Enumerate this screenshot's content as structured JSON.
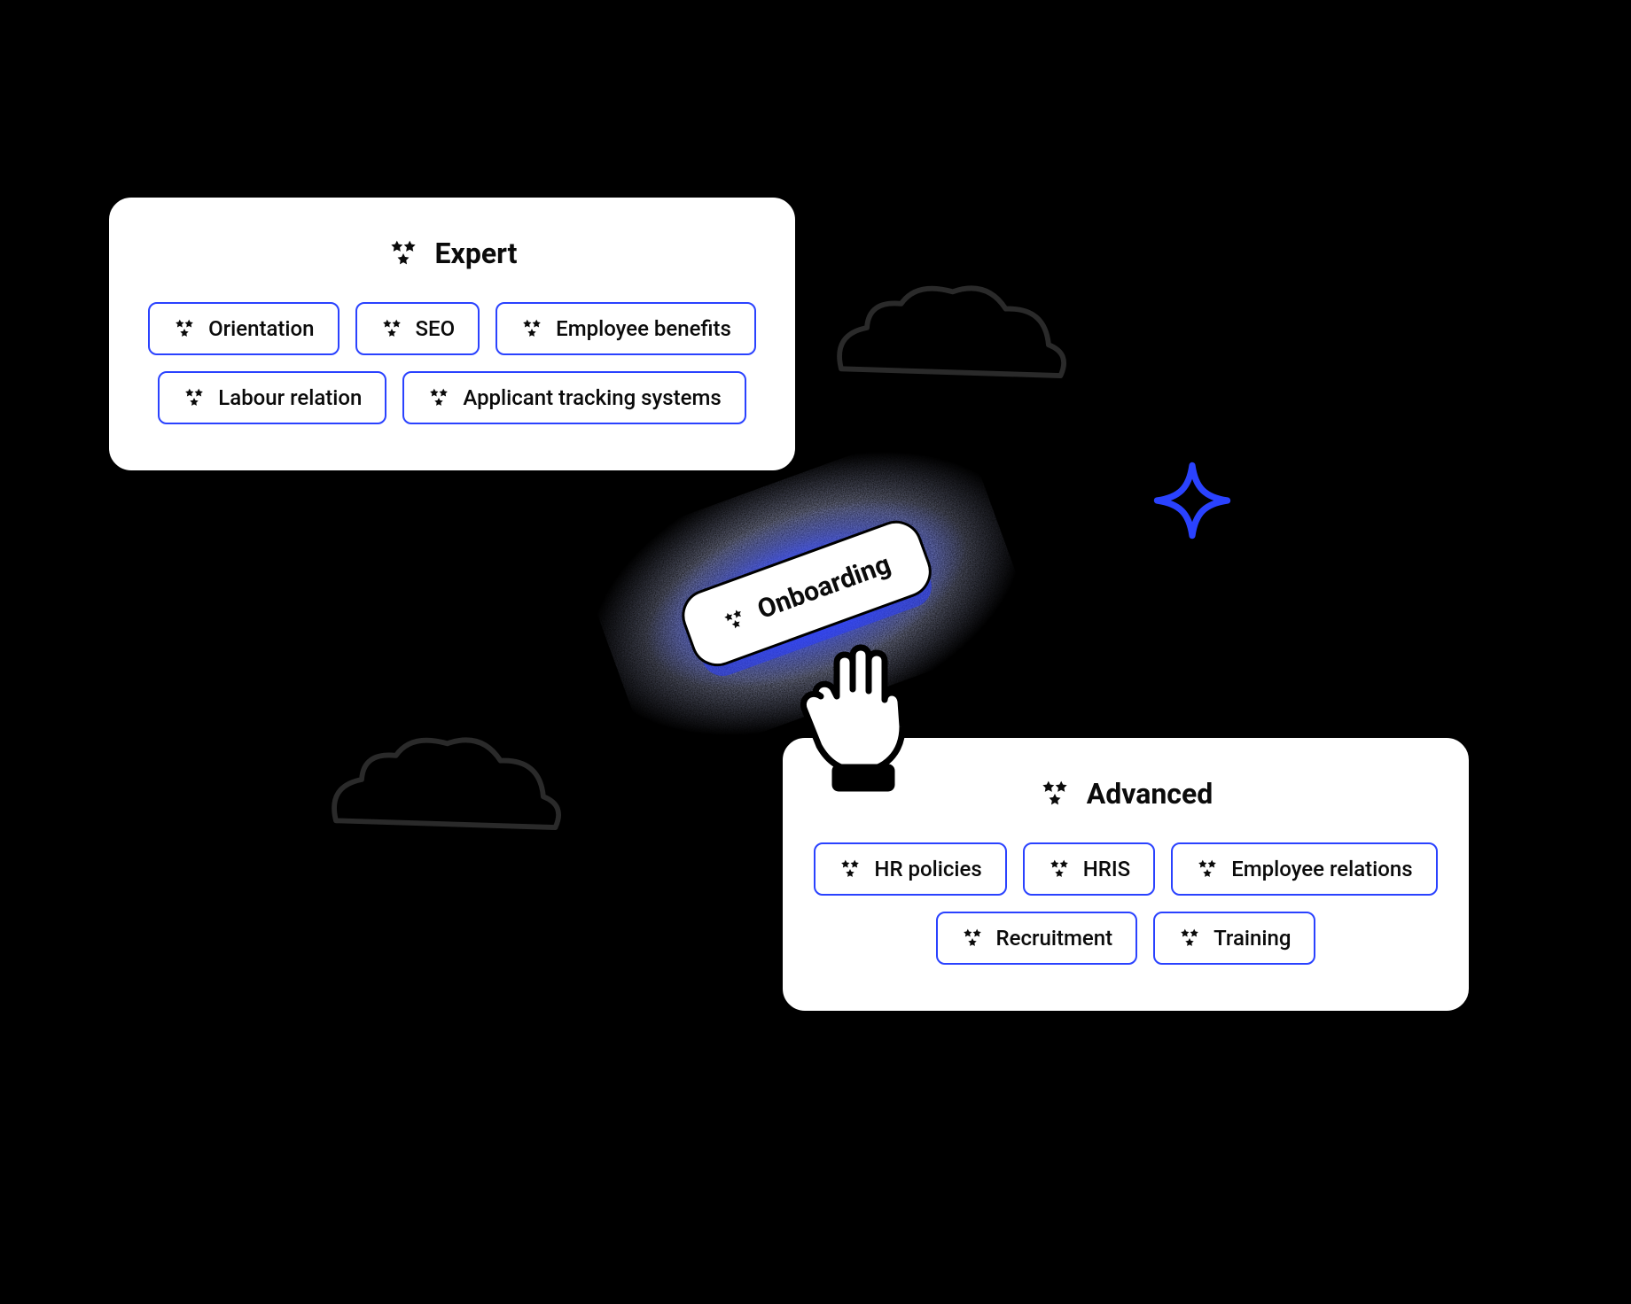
{
  "expert": {
    "title": "Expert",
    "chips": {
      "orientation": "Orientation",
      "seo": "SEO",
      "employee_benefits": "Employee benefits",
      "labour_relation": "Labour relation",
      "ats": "Applicant tracking systems"
    }
  },
  "advanced": {
    "title": "Advanced",
    "chips": {
      "hr_policies": "HR policies",
      "hris": "HRIS",
      "employee_relations": "Employee relations",
      "recruitment": "Recruitment",
      "training": "Training"
    }
  },
  "dragging": {
    "label": "Onboarding"
  },
  "colors": {
    "chip_border": "#2a42ff",
    "glow": "#3c50ff"
  }
}
